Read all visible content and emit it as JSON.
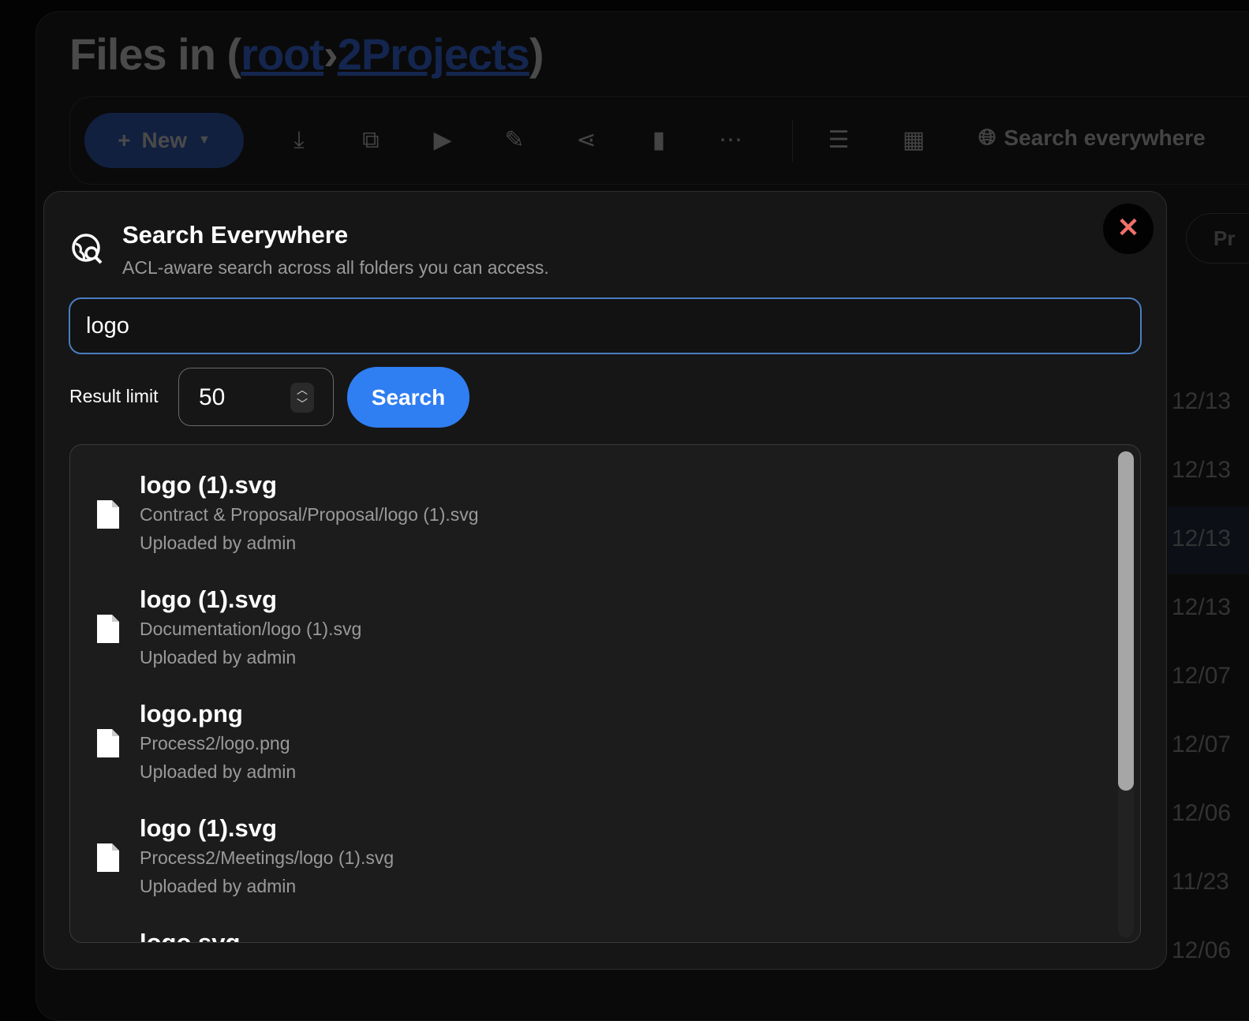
{
  "header": {
    "prefix": "Files in (",
    "crumb1": "root",
    "sep": "›",
    "crumb2": "2Projects",
    "suffix": ")"
  },
  "toolbar": {
    "new_label": "New",
    "search_everywhere": "Search everywhere",
    "icons": [
      "download-icon",
      "copy-icon",
      "move-icon",
      "rename-icon",
      "share-icon",
      "delete-icon",
      "more-icon",
      "filter-icon",
      "grid-icon"
    ]
  },
  "background": {
    "pill": "Pr",
    "dates": [
      "12/13",
      "12/13",
      "12/13",
      "12/13",
      "12/07",
      "12/07",
      "12/06",
      "11/23",
      "12/06"
    ]
  },
  "modal": {
    "title": "Search Everywhere",
    "subtitle": "ACL-aware search across all folders you can access.",
    "query": "logo",
    "result_limit_label": "Result limit",
    "result_limit": "50",
    "search_label": "Search",
    "results": [
      {
        "name": "logo (1).svg",
        "path": "Contract & Proposal/Proposal/logo (1).svg",
        "uploader": "Uploaded by admin"
      },
      {
        "name": "logo (1).svg",
        "path": "Documentation/logo (1).svg",
        "uploader": "Uploaded by admin"
      },
      {
        "name": "logo.png",
        "path": "Process2/logo.png",
        "uploader": "Uploaded by admin"
      },
      {
        "name": "logo (1).svg",
        "path": "Process2/Meetings/logo (1).svg",
        "uploader": "Uploaded by admin"
      },
      {
        "name": "logo.svg",
        "path": "",
        "uploader": ""
      }
    ],
    "close_color": "#f0706a",
    "accent": "#2f7ef2"
  }
}
